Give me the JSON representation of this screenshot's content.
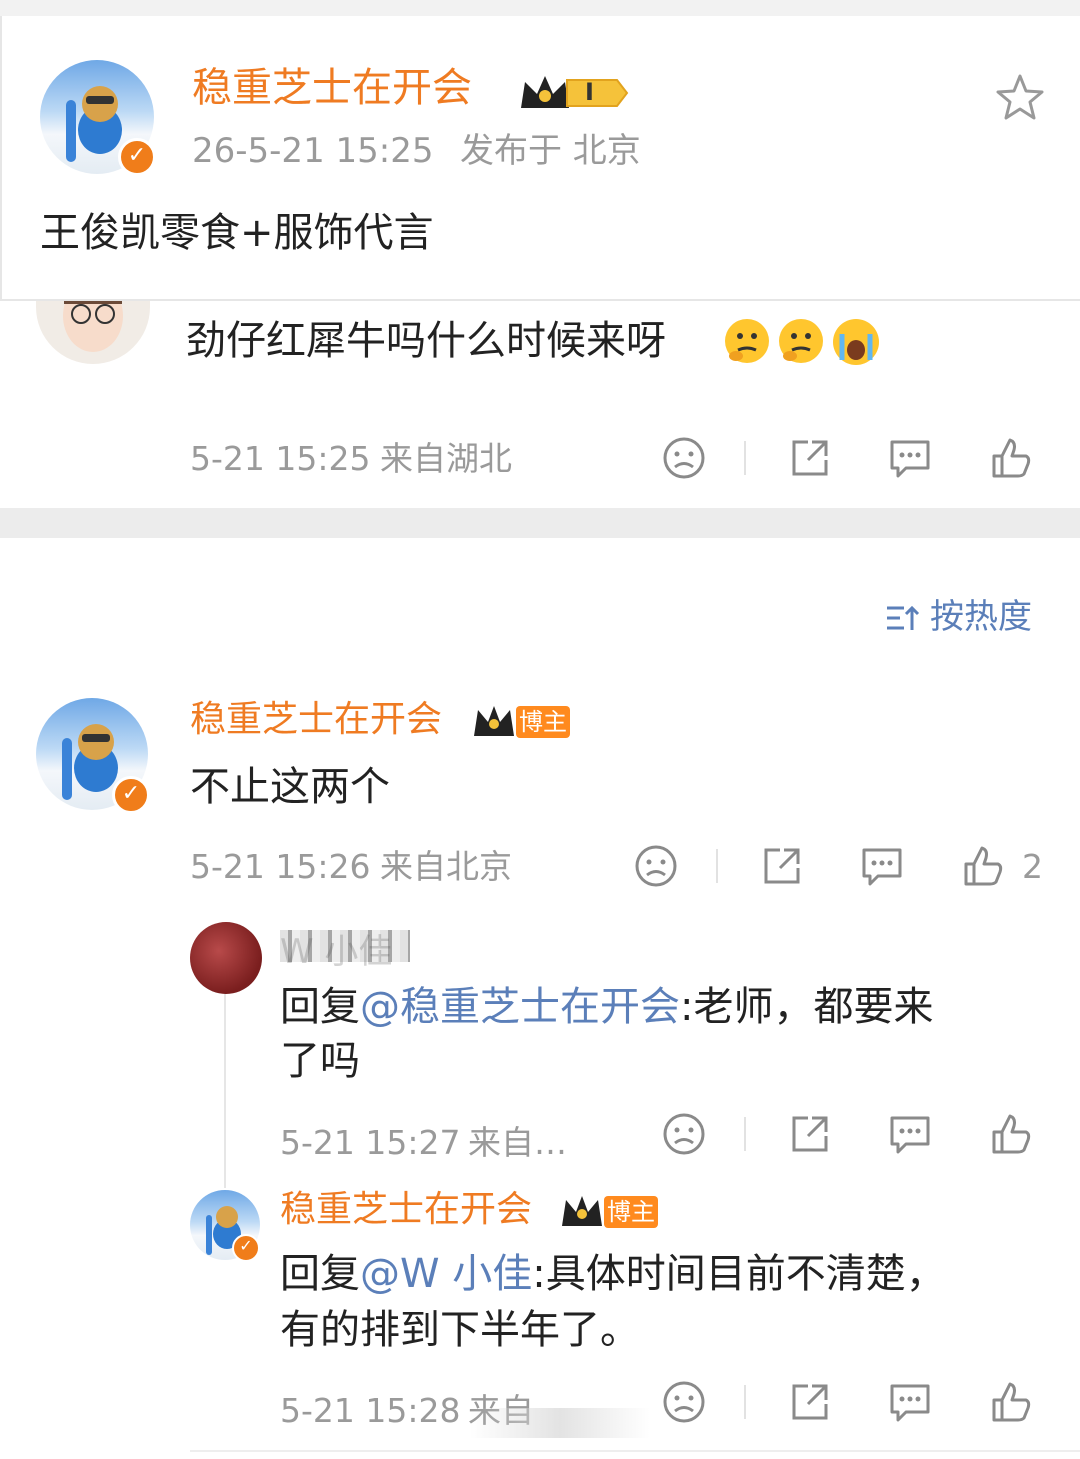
{
  "post": {
    "author": "稳重芝士在开会",
    "level_badge": "I",
    "time": "26-5-21 15:25",
    "location": "发布于 北京",
    "content": "王俊凯零食+服饰代言"
  },
  "prev_comment": {
    "text": "劲仔红犀牛吗什么时候来呀",
    "emojis": [
      "thinking-emoji",
      "thinking-emoji",
      "crying-emoji"
    ],
    "time": "5-21 15:25",
    "location": "来自湖北"
  },
  "sort": {
    "label": "按热度"
  },
  "comment": {
    "author": "稳重芝士在开会",
    "tag": "博主",
    "text": "不止这两个",
    "time": "5-21 15:26",
    "location": "来自北京",
    "like_count": "2"
  },
  "replies": [
    {
      "author": "W  小佳",
      "prefix": "回复",
      "mention": "@稳重芝士在开会",
      "text_line1": ":老师，都要来",
      "text_line2": "了吗",
      "time": "5-21 15:27",
      "location": "来自…"
    },
    {
      "author": "稳重芝士在开会",
      "tag": "博主",
      "prefix": "回复",
      "mention": "@W  小佳",
      "text_line1": ":具体时间目前不清楚，",
      "text_line2": "有的排到下半年了。",
      "time": "5-21 15:28",
      "location": "来自"
    }
  ],
  "colors": {
    "accent": "#ef7b22",
    "link": "#5b7fb9",
    "meta": "#9a9a9a",
    "badge_orange": "#ff8a1e"
  }
}
